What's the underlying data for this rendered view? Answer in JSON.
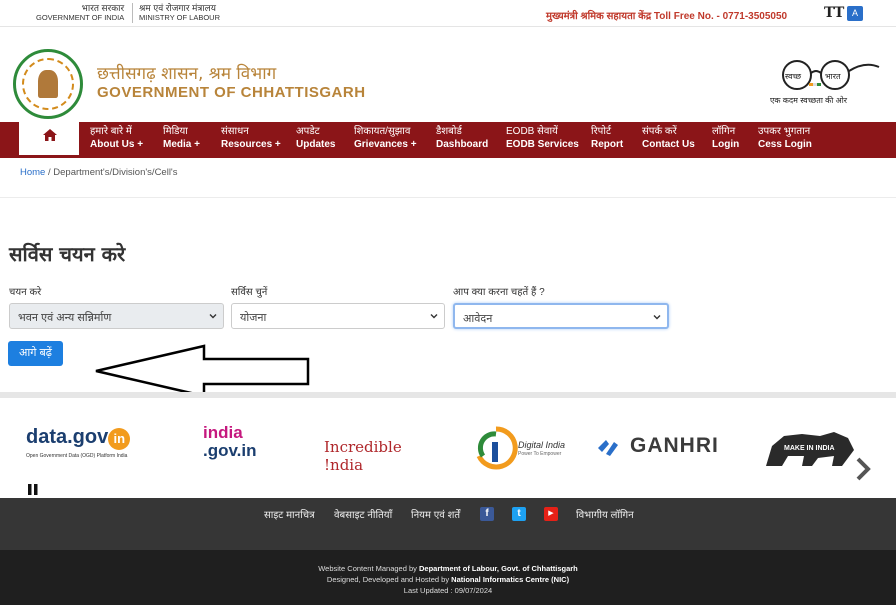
{
  "topbar": {
    "gov_india_hi": "भारत सरकार",
    "gov_india_en": "GOVERNMENT OF INDIA",
    "labour_hi": "श्रम एवं रोजगार मंत्रालय",
    "labour_en": "MINISTRY OF LABOUR",
    "toll_free": "मुख्यमंत्री श्रमिक सहायता केंद्र Toll Free No. - 0771-3505050",
    "text_size_icon": "text-size-icon",
    "text_size_glyph": "TT",
    "language_icon": "language-icon",
    "language_glyph": "A"
  },
  "header": {
    "title_hi": "छत्तीसगढ़ शासन, श्रम विभाग",
    "title_en": "GOVERNMENT OF CHHATTISGARH",
    "swachh_left": "स्वच्छ",
    "swachh_right": "भारत",
    "swachh_tagline": "एक कदम स्वच्छता की ओर"
  },
  "nav": {
    "items": [
      {
        "hi": "हमारे बारे में",
        "en": "About Us +"
      },
      {
        "hi": "मिडिया",
        "en": "Media +"
      },
      {
        "hi": "संसाधन",
        "en": "Resources +"
      },
      {
        "hi": "अपडेट",
        "en": "Updates"
      },
      {
        "hi": "शिकायत/सुझाव",
        "en": "Grievances +"
      },
      {
        "hi": "डैशबोर्ड",
        "en": "Dashboard"
      },
      {
        "hi": "EODB सेवायें",
        "en": "EODB Services"
      },
      {
        "hi": "रिपोर्ट",
        "en": "Report"
      },
      {
        "hi": "संपर्क करें",
        "en": "Contact Us"
      },
      {
        "hi": "लॉगिन",
        "en": "Login"
      },
      {
        "hi": "उपकर भुगतान",
        "en": "Cess Login"
      }
    ]
  },
  "breadcrumb": {
    "home": "Home",
    "separator": " / ",
    "current": "Department's/Division's/Cell's"
  },
  "main": {
    "title": "सर्विस चयन करे",
    "field1_label": "चयन करे",
    "field1_value": "भवन एवं अन्य सन्निर्माण",
    "field2_label": "सर्विस चुनें",
    "field2_value": "योजना",
    "field3_label": "आप क्या करना चहतें हैं ?",
    "field3_value": "आवेदन",
    "next_button": "आगे बढ़ें"
  },
  "logos": {
    "datagov_main": "data.gov",
    "datagov_badge": "in",
    "datagov_sub": "Open Government Data (OGD) Platform India",
    "indiagov_top": "india",
    "indiagov_bottom": ".gov.in",
    "incredible": "Incredible !ndia",
    "digital_title": "Digital India",
    "digital_sub": "Power To Empower",
    "ganhri": "GANHRI",
    "makeinindia": "MAKE IN INDIA"
  },
  "footer": {
    "links": [
      "साइट मानचित्र",
      "वेबसाइट नीतियाँ",
      "नियम एवं शर्तें",
      "विभागीय लॉगिन"
    ],
    "social": {
      "facebook": "f",
      "twitter": "t",
      "youtube": "▶"
    },
    "managed_prefix": "Website Content Managed by ",
    "managed_by": "Department of Labour, Govt. of Chhattisgarh",
    "hosted_prefix": "Designed, Developed and Hosted by ",
    "hosted_by": "National Informatics Centre (NIC)",
    "last_updated": "Last Updated : 09/07/2024"
  },
  "colors": {
    "nav_bg": "#8b1518",
    "title": "#b8843a",
    "button": "#1d7fe0",
    "footer_dark": "#1f1f1f"
  }
}
